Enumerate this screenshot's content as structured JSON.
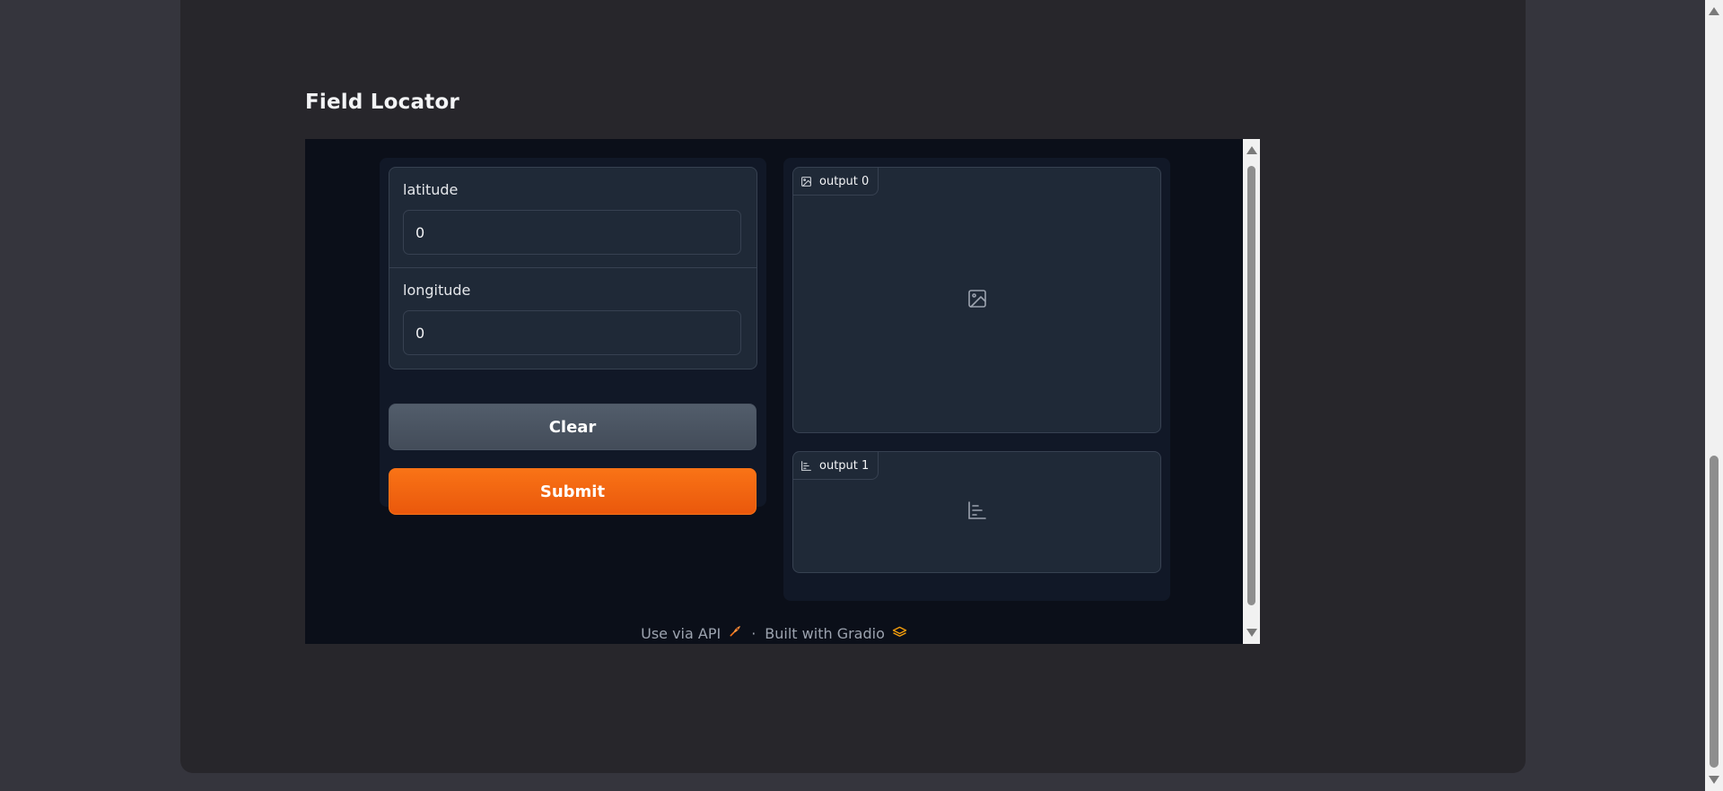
{
  "app": {
    "title": "Field Locator"
  },
  "inputs": [
    {
      "label": "latitude",
      "value": "0"
    },
    {
      "label": "longitude",
      "value": "0"
    }
  ],
  "buttons": {
    "clear": "Clear",
    "submit": "Submit"
  },
  "outputs": [
    {
      "label": "output 0",
      "icon": "image-icon"
    },
    {
      "label": "output 1",
      "icon": "bar-chart-icon"
    }
  ],
  "footer": {
    "api_link": "Use via API",
    "separator": "·",
    "built_with": "Built with Gradio"
  },
  "colors": {
    "accent": "#f97316",
    "panel": "#1f2937",
    "frame_bg": "#0b0f19"
  }
}
